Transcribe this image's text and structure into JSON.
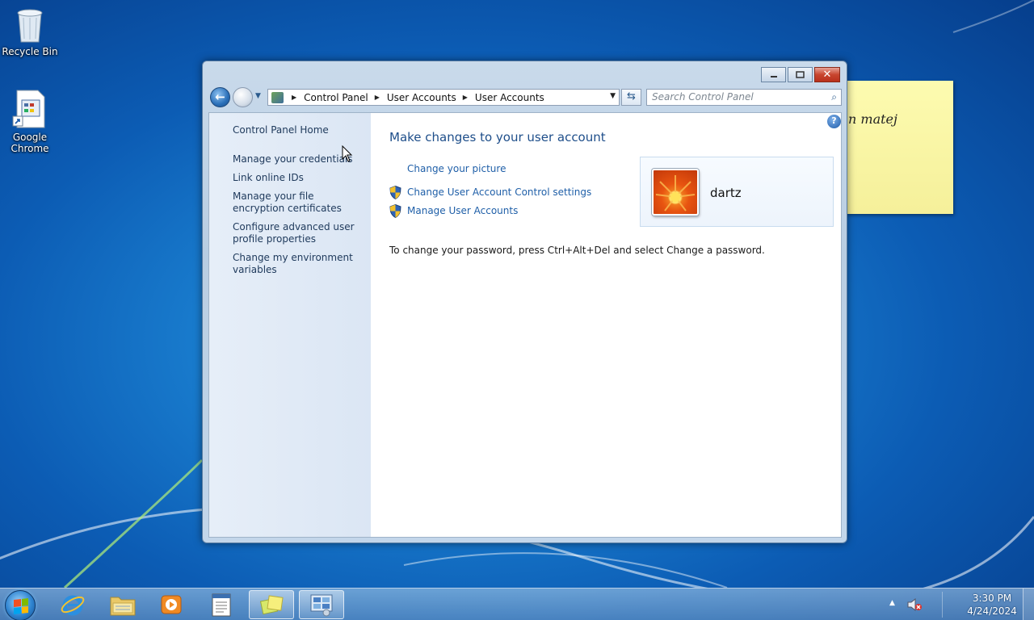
{
  "desktop": {
    "icons": [
      {
        "label": "Recycle Bin",
        "icon": "recycle-bin-icon"
      },
      {
        "label": "Google\nChrome",
        "icon": "chrome-shortcut-icon"
      }
    ],
    "sticky_note": {
      "text": "n matej"
    }
  },
  "window": {
    "caption": {
      "minimize": "minimize",
      "maximize": "maximize",
      "close": "close"
    },
    "nav": {
      "breadcrumb": [
        "Control Panel",
        "User Accounts",
        "User Accounts"
      ],
      "search_placeholder": "Search Control Panel"
    },
    "sidebar": {
      "home": "Control Panel Home",
      "items": [
        "Manage your credentials",
        "Link online IDs",
        "Manage your file encryption certificates",
        "Configure advanced user profile properties",
        "Change my environment variables"
      ]
    },
    "main": {
      "title": "Make changes to your user account",
      "tasks": [
        {
          "label": "Change your picture",
          "icon": null
        },
        {
          "label": "Change User Account Control settings",
          "icon": "uac-shield-icon"
        },
        {
          "label": "Manage User Accounts",
          "icon": "uac-shield-icon"
        }
      ],
      "info": "To change your password, press Ctrl+Alt+Del and select Change a password.",
      "user": {
        "name": "dartz"
      }
    }
  },
  "taskbar": {
    "pinned": [
      "internet-explorer-icon",
      "windows-explorer-icon",
      "media-player-icon",
      "notepad-icon",
      "sticky-notes-icon",
      "control-panel-icon"
    ],
    "clock": {
      "time": "3:30 PM",
      "date": "4/24/2024"
    }
  },
  "colors": {
    "link": "#1f5fa8",
    "title": "#1e4e8a",
    "sidebar_link": "#1e395b",
    "sticky": "#fdfbb0"
  }
}
